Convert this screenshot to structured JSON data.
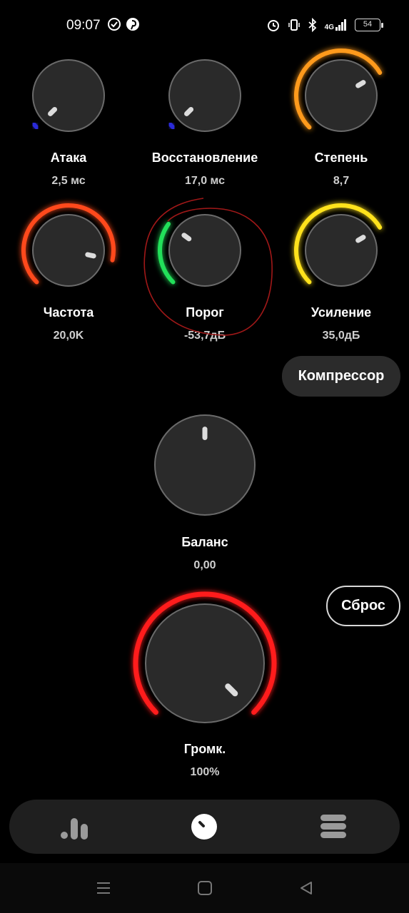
{
  "status_bar": {
    "time": "09:07",
    "left_icons": [
      "check-circle-icon",
      "pinterest-icon"
    ],
    "right_icons": [
      "alarm-icon",
      "vibrate-icon",
      "bluetooth-icon",
      "signal-4g-icon"
    ],
    "network": "4G",
    "battery": "54"
  },
  "knobs": [
    {
      "id": "attack",
      "label": "Атака",
      "value": "2,5 мс",
      "level": 0.0,
      "color": "#2a2ad8"
    },
    {
      "id": "release",
      "label": "Восстановление",
      "value": "17,0 мс",
      "level": 0.0,
      "color": "#2a2ad8"
    },
    {
      "id": "ratio",
      "label": "Степень",
      "value": "8,7",
      "level": 0.72,
      "color": "#ff9a1a"
    },
    {
      "id": "frequency",
      "label": "Частота",
      "value": "20,0K",
      "level": 0.88,
      "color": "#ff4a1a"
    },
    {
      "id": "threshold",
      "label": "Порог",
      "value": "-53,7дБ",
      "level": 0.3,
      "color": "#22e05a"
    },
    {
      "id": "gain",
      "label": "Усиление",
      "value": "35,0дБ",
      "level": 0.72,
      "color": "#ffe21a"
    },
    {
      "id": "balance",
      "label": "Баланс",
      "value": "0,00",
      "level": 0.5,
      "color": "#ffffff"
    },
    {
      "id": "volume",
      "label": "Громк.",
      "value": "100%",
      "level": 1.0,
      "color": "#ff1a1a"
    }
  ],
  "buttons": {
    "compressor": "Компрессор",
    "reset": "Сброс"
  },
  "bottom_nav": {
    "items": [
      {
        "id": "equalizer",
        "icon": "equalizer-bars-icon"
      },
      {
        "id": "knobs",
        "icon": "knob-icon"
      },
      {
        "id": "presets",
        "icon": "list-stack-icon"
      }
    ],
    "active": "knobs"
  },
  "system_nav": [
    "menu-icon",
    "home-icon",
    "back-icon"
  ]
}
